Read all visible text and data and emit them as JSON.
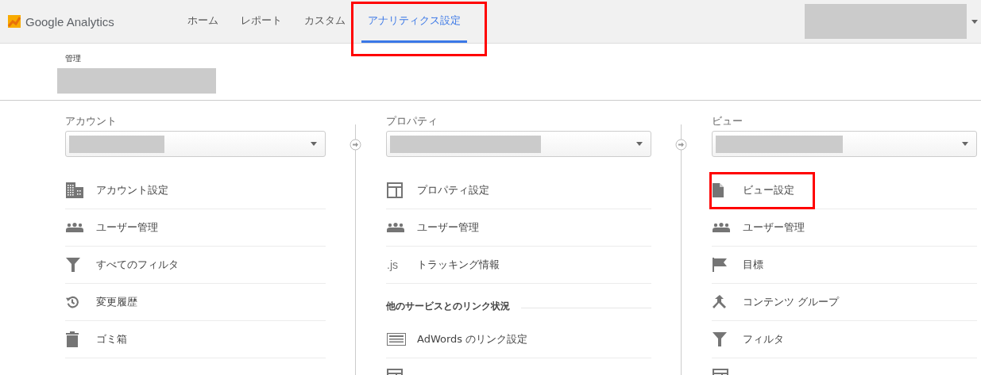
{
  "header": {
    "logo": "Google Analytics",
    "nav": [
      {
        "label": "ホーム",
        "selected": false,
        "highlighted": false
      },
      {
        "label": "レポート",
        "selected": false,
        "highlighted": false
      },
      {
        "label": "カスタム",
        "selected": false,
        "highlighted": false
      },
      {
        "label": "アナリティクス設定",
        "selected": true,
        "highlighted": true
      }
    ]
  },
  "admin": {
    "title": "管理"
  },
  "columns": [
    {
      "heading": "アカウント",
      "items": [
        {
          "kind": "building",
          "label": "アカウント設定",
          "highlighted": false
        },
        {
          "kind": "people",
          "label": "ユーザー管理",
          "highlighted": false
        },
        {
          "kind": "funnel",
          "label": "すべてのフィルタ",
          "highlighted": false
        },
        {
          "kind": "history",
          "label": "変更履歴",
          "highlighted": false
        },
        {
          "kind": "trash",
          "label": "ゴミ箱",
          "highlighted": false
        }
      ]
    },
    {
      "heading": "プロパティ",
      "items": [
        {
          "kind": "panel",
          "label": "プロパティ設定",
          "highlighted": false
        },
        {
          "kind": "people",
          "label": "ユーザー管理",
          "highlighted": false
        },
        {
          "kind": "code",
          "icon_text": ".js",
          "label": "トラッキング情報",
          "highlighted": false
        }
      ],
      "section": {
        "title": "他のサービスとのリンク状況",
        "items": [
          {
            "kind": "lines",
            "label": "AdWords のリンク設定",
            "highlighted": false
          },
          {
            "kind": "panel",
            "highlighted": false
          }
        ]
      }
    },
    {
      "heading": "ビュー",
      "items": [
        {
          "kind": "doc",
          "label": "ビュー設定",
          "highlighted": true
        },
        {
          "kind": "people",
          "label": "ユーザー管理",
          "highlighted": false
        },
        {
          "kind": "flag",
          "label": "目標",
          "highlighted": false
        },
        {
          "kind": "branch",
          "label": "コンテンツ グループ",
          "highlighted": false
        },
        {
          "kind": "funnel",
          "label": "フィルタ",
          "highlighted": false
        },
        {
          "kind": "panel",
          "highlighted": false
        }
      ]
    }
  ]
}
